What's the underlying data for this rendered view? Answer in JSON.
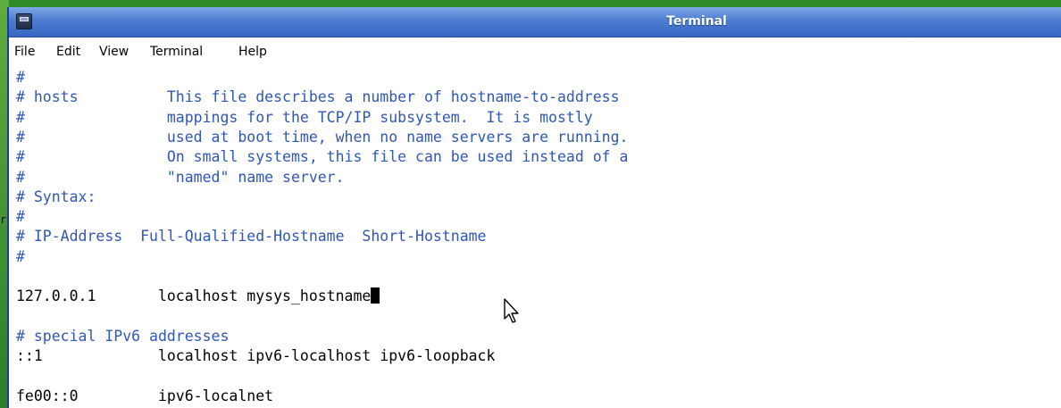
{
  "window": {
    "title": "Terminal"
  },
  "menu": [
    "File",
    "Edit",
    "View",
    "Terminal",
    "Help"
  ],
  "desktop_glyph": "r",
  "terminal": {
    "lines": [
      {
        "text": "#",
        "type": "comment"
      },
      {
        "text": "# hosts          This file describes a number of hostname-to-address",
        "type": "comment"
      },
      {
        "text": "#                mappings for the TCP/IP subsystem.  It is mostly",
        "type": "comment"
      },
      {
        "text": "#                used at boot time, when no name servers are running.",
        "type": "comment"
      },
      {
        "text": "#                On small systems, this file can be used instead of a",
        "type": "comment"
      },
      {
        "text": "#                \"named\" name server.",
        "type": "comment"
      },
      {
        "text": "# Syntax:",
        "type": "comment"
      },
      {
        "text": "#",
        "type": "comment"
      },
      {
        "text": "# IP-Address  Full-Qualified-Hostname  Short-Hostname",
        "type": "comment"
      },
      {
        "text": "#",
        "type": "comment"
      },
      {
        "text": "",
        "type": "blank"
      },
      {
        "text": "127.0.0.1       localhost mysys_hostname",
        "type": "normal",
        "cursor": true
      },
      {
        "text": "",
        "type": "blank"
      },
      {
        "text": "# special IPv6 addresses",
        "type": "comment"
      },
      {
        "text": "::1             localhost ipv6-localhost ipv6-loopback",
        "type": "normal"
      },
      {
        "text": "",
        "type": "blank"
      },
      {
        "text": "fe00::0         ipv6-localnet",
        "type": "normal"
      }
    ]
  },
  "colors": {
    "comment": "#2f57b5",
    "text": "#000000",
    "titlebar": "#4d7dd2"
  }
}
